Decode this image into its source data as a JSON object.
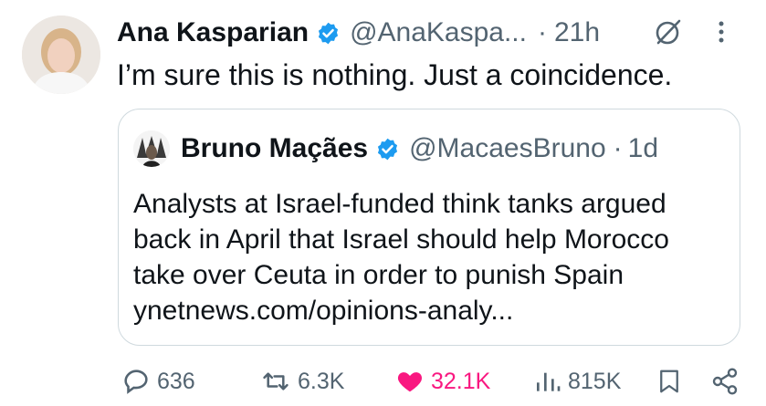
{
  "tweet": {
    "author_name": "Ana Kasparian",
    "handle": "@AnaKaspa...",
    "separator": "·",
    "time": "21h",
    "text": "I’m sure this is nothing. Just a coincidence.",
    "icons": {
      "verified": "verified-badge-icon",
      "grok": "grok-icon",
      "more": "more-options-icon"
    }
  },
  "quoted": {
    "author_name": "Bruno Maçães",
    "handle": "@MacaesBruno",
    "separator": "·",
    "time": "1d",
    "lines": [
      "Analysts at Israel-funded think tanks argued",
      "back in April that Israel should help Morocco",
      "take over Ceuta in order to punish Spain",
      "ynetnews.com/opinions-analy..."
    ]
  },
  "actions": {
    "replies": "636",
    "reposts": "6.3K",
    "likes": "32.1K",
    "views": "815K",
    "liked": true
  },
  "colors": {
    "text": "#0f1419",
    "secondary": "#536471",
    "verified": "#1d9bf0",
    "like": "#f91880",
    "border": "#cfd9de"
  }
}
